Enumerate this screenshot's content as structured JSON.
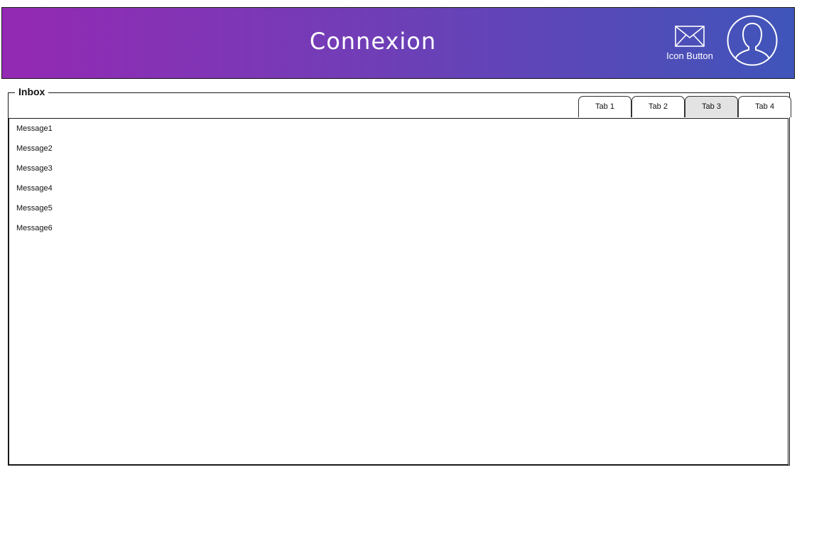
{
  "header": {
    "title": "Connexion",
    "icon_button": {
      "icon": "mail-icon",
      "label": "Icon Button"
    },
    "avatar_icon": "user-avatar-icon",
    "gradient_colors": [
      "#9429b4",
      "#3f55b9"
    ]
  },
  "inbox": {
    "legend": "Inbox",
    "tabs": [
      {
        "label": "Tab 1",
        "active": false
      },
      {
        "label": "Tab 2",
        "active": false
      },
      {
        "label": "Tab 3",
        "active": true
      },
      {
        "label": "Tab 4",
        "active": false
      }
    ],
    "messages": [
      "Message1",
      "Message2",
      "Message3",
      "Message4",
      "Message5",
      "Message6"
    ]
  }
}
